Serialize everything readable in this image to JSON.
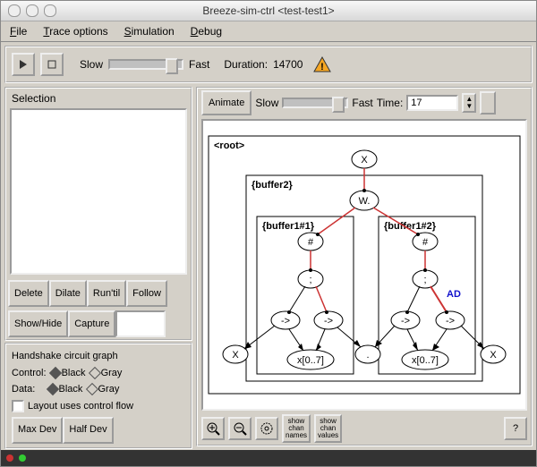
{
  "window": {
    "title": "Breeze-sim-ctrl <test-test1>",
    "icon": "app-icon"
  },
  "menus": {
    "file": "File",
    "trace": "Trace options",
    "sim": "Simulation",
    "debug": "Debug"
  },
  "main_toolbar": {
    "play": "▶",
    "stop": "□",
    "slow": "Slow",
    "fast": "Fast",
    "duration_label": "Duration:",
    "duration": "14700",
    "warn": "!"
  },
  "selection": {
    "heading": "Selection",
    "buttons": {
      "delete": "Delete",
      "dilate": "Dilate",
      "runtil": "Run'til",
      "follow": "Follow",
      "showhide": "Show/Hide",
      "capture": "Capture"
    },
    "capture_value": ""
  },
  "graph_opts": {
    "heading": "Handshake circuit graph",
    "control": "Control:",
    "data": "Data:",
    "black": "Black",
    "gray": "Gray",
    "layout": "Layout uses control flow",
    "maxdev": "Max Dev",
    "halfdev": "Half Dev"
  },
  "anim": {
    "animate": "Animate",
    "slow": "Slow",
    "fast": "Fast",
    "time_label": "Time:",
    "time": "17"
  },
  "bottom": {
    "zoom_in": "+",
    "zoom_out": "−",
    "zoom_fit": "⤢",
    "show_names": "show\nchan\nnames",
    "show_values": "show\nchan\nvalues",
    "help": "?"
  },
  "diagram": {
    "root_label": "<root>",
    "buffer2": "{buffer2}",
    "buffer1a": "{buffer1#1}",
    "buffer1b": "{buffer1#2}",
    "ad": "AD",
    "x": "X",
    "w": "W.",
    "hash": "#",
    "semi": ";",
    "arrow": "->",
    "dot": ".",
    "bus": "x[0..7]"
  }
}
